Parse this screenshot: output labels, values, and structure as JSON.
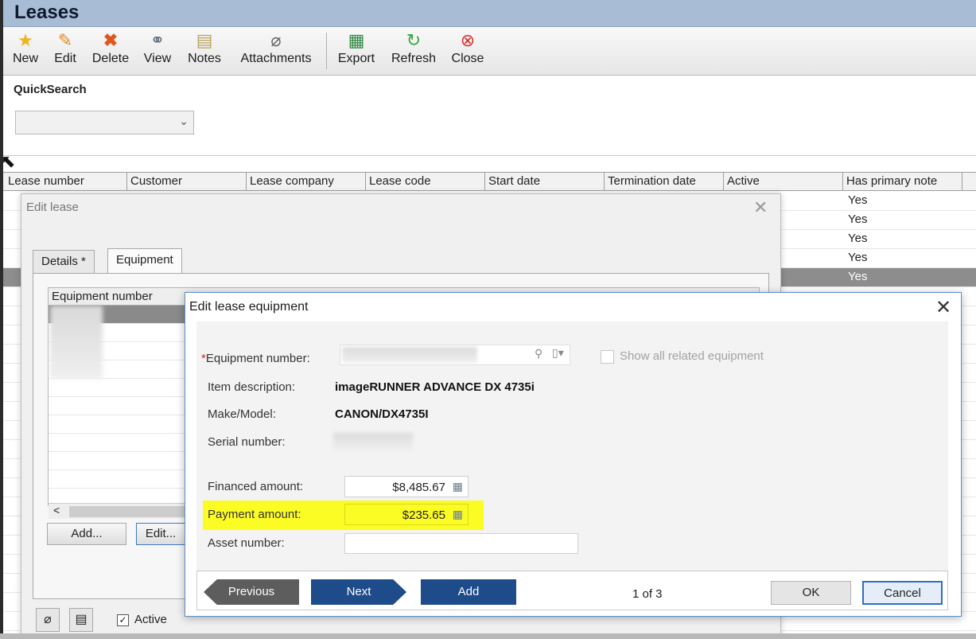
{
  "app": {
    "title": "Leases"
  },
  "toolbar": {
    "buttons": [
      {
        "label": "New",
        "icon": "star-icon"
      },
      {
        "label": "Edit",
        "icon": "pencil-icon"
      },
      {
        "label": "Delete",
        "icon": "x-icon"
      },
      {
        "label": "View",
        "icon": "binoculars-icon"
      },
      {
        "label": "Notes",
        "icon": "notes-icon"
      },
      {
        "label": "Attachments",
        "icon": "paperclip-icon"
      },
      {
        "label": "Export",
        "icon": "export-icon"
      },
      {
        "label": "Refresh",
        "icon": "refresh-icon"
      },
      {
        "label": "Close",
        "icon": "close-icon"
      }
    ]
  },
  "quicksearch": {
    "label": "QuickSearch",
    "selected": ""
  },
  "grid": {
    "columns": [
      "Lease number",
      "Customer",
      "Lease company",
      "Lease code",
      "Start date",
      "Termination date",
      "Active",
      "Has primary note"
    ],
    "has_primary_note_values": [
      "Yes",
      "Yes",
      "Yes",
      "Yes",
      "Yes"
    ]
  },
  "edit_lease": {
    "title": "Edit lease",
    "tabs": [
      "Details *",
      "Equipment"
    ],
    "equipment_grid_header": "Equipment number",
    "add_button": "Add...",
    "edit_button": "Edit...",
    "active_label": "Active"
  },
  "edit_equipment": {
    "title": "Edit lease equipment",
    "fields": {
      "equipment_number_label": "Equipment number:",
      "show_all_label": "Show all related equipment",
      "item_description_label": "Item description:",
      "item_description_value": "imageRUNNER ADVANCE DX 4735i",
      "make_model_label": "Make/Model:",
      "make_model_value": "CANON/DX4735I",
      "serial_number_label": "Serial number:",
      "financed_amount_label": "Financed amount:",
      "financed_amount_value": "$8,485.67",
      "payment_amount_label": "Payment amount:",
      "payment_amount_value": "$235.65",
      "asset_number_label": "Asset number:",
      "asset_number_value": ""
    },
    "footer": {
      "previous": "Previous",
      "next": "Next",
      "add": "Add",
      "page_indicator": "1 of 3",
      "ok": "OK",
      "cancel": "Cancel"
    }
  },
  "colors": {
    "highlight": "#fcfc25",
    "nav_blue": "#1e4b8a",
    "nav_gray": "#5d5d5d",
    "title_bar": "#a9bcd6"
  }
}
